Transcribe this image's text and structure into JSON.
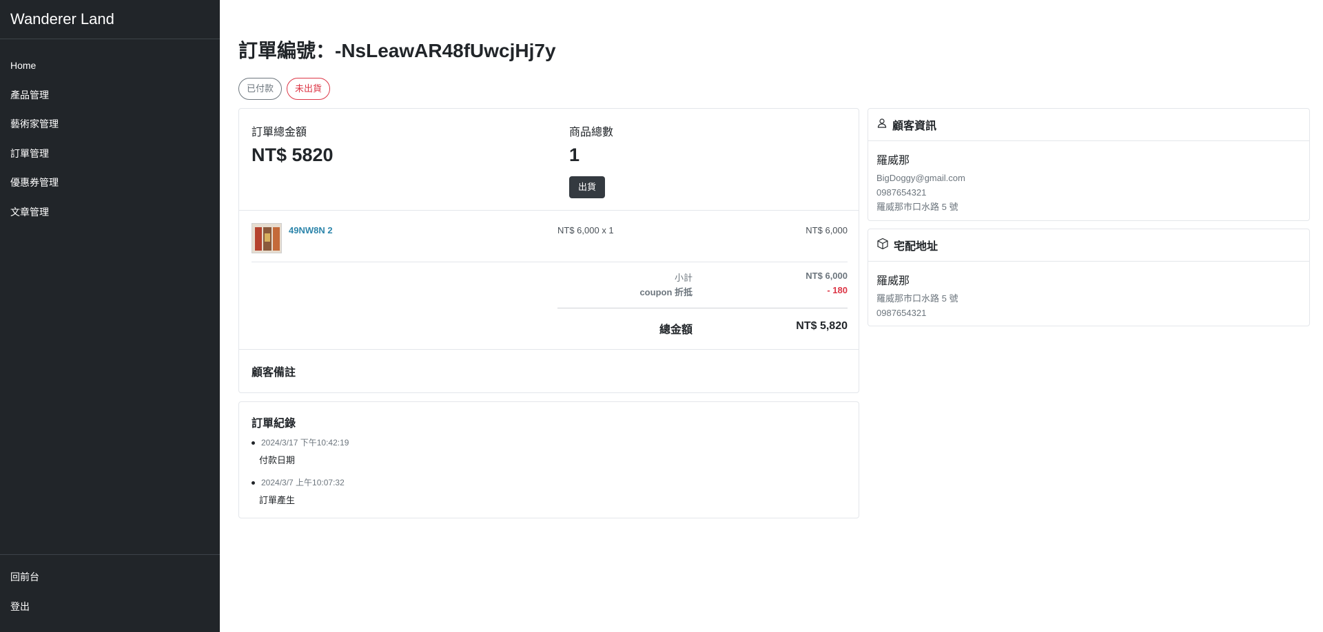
{
  "sidebar": {
    "brand": "Wanderer Land",
    "items": [
      {
        "label": "Home"
      },
      {
        "label": "產品管理"
      },
      {
        "label": "藝術家管理"
      },
      {
        "label": "訂單管理"
      },
      {
        "label": "優惠券管理"
      },
      {
        "label": "文章管理"
      }
    ],
    "footer": [
      {
        "label": "回前台"
      },
      {
        "label": "登出"
      }
    ]
  },
  "page": {
    "title": "訂單編號：-NsLeawAR48fUwcjHj7y",
    "badges": {
      "paid": "已付款",
      "shipped": "未出貨"
    }
  },
  "order": {
    "total_label": "訂單總金額",
    "total_value": "NT$ 5820",
    "count_label": "商品總數",
    "count_value": "1",
    "ship_button": "出貨",
    "item": {
      "name": "49NW8N 2",
      "unit_qty": "NT$ 6,000 x 1",
      "line_total": "NT$ 6,000"
    },
    "subtotal_label": "小計",
    "subtotal_value": "NT$ 6,000",
    "coupon_label": "coupon 折抵",
    "coupon_value": "- 180",
    "grand_label": "總金額",
    "grand_value": "NT$ 5,820",
    "note_label": "顧客備註"
  },
  "log": {
    "title": "訂單紀錄",
    "entries": [
      {
        "time": "2024/3/17 下午10:42:19",
        "event": "付款日期"
      },
      {
        "time": "2024/3/7 上午10:07:32",
        "event": "訂單產生"
      }
    ]
  },
  "customer": {
    "title": "顧客資訊",
    "name": "羅威那",
    "email": "BigDoggy@gmail.com",
    "phone": "0987654321",
    "address": "羅威那市口水路 5 號"
  },
  "shipping": {
    "title": "宅配地址",
    "name": "羅威那",
    "address": "羅威那市口水路 5 號",
    "phone": "0987654321"
  },
  "colors": {
    "sidebar": "#212529",
    "danger": "#dc3545",
    "link": "#2e86ab"
  }
}
